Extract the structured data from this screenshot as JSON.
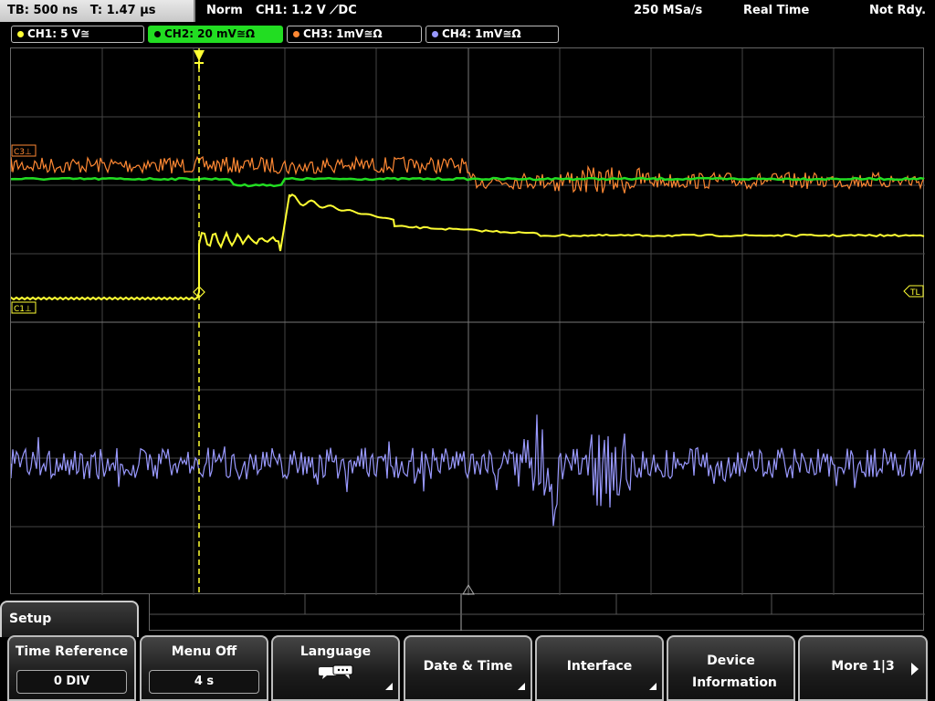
{
  "status": {
    "timebase": "TB: 500 ns",
    "trigger_time": "T: 1.47 µs",
    "trigger_mode": "Norm",
    "trigger_source": "CH1: 1.2 V ⟋DC",
    "sample_rate": "250 MSa/s",
    "acq_mode": "Real Time",
    "state": "Not Rdy."
  },
  "channels": [
    {
      "label": "CH1: 5 V≅",
      "color": "#ffff33"
    },
    {
      "label": "CH2: 20 mV≅Ω",
      "color": "#22dd22"
    },
    {
      "label": "CH3: 1mV≅Ω",
      "color": "#ff8833"
    },
    {
      "label": "CH4: 1mV≅Ω",
      "color": "#9999ff"
    }
  ],
  "markers": {
    "c3": "C3⊥",
    "c1": "C1⊥",
    "tl": "TL"
  },
  "menu": {
    "title": "Setup",
    "keys": [
      {
        "label": "Time Reference",
        "value": "0 DIV"
      },
      {
        "label": "Menu Off",
        "value": "4 s"
      },
      {
        "label": "Language"
      },
      {
        "label": "Date & Time"
      },
      {
        "label": "Interface"
      },
      {
        "label": "Device Information"
      },
      {
        "label": "More 1|3"
      }
    ]
  },
  "icons": {
    "language": "speech-bubble-icon",
    "more": "arrow-right-icon"
  }
}
